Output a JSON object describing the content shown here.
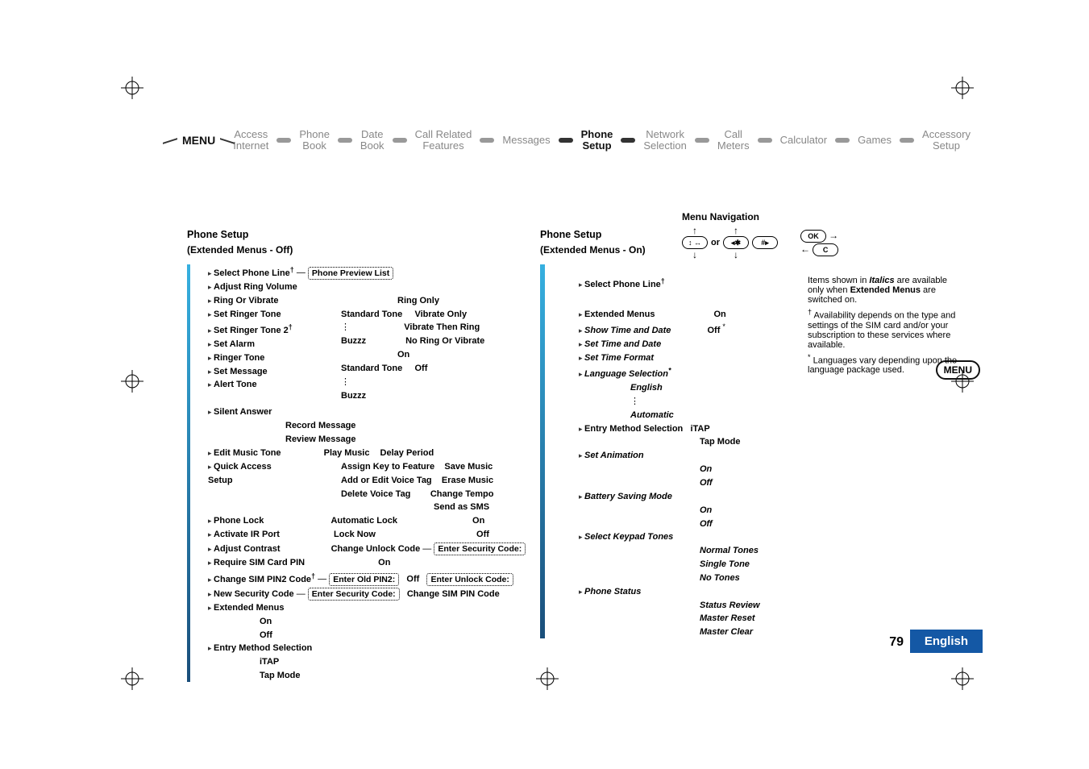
{
  "ribbon": {
    "label": "MENU",
    "items": [
      {
        "line1": "Access",
        "line2": "Internet"
      },
      {
        "line1": "Phone",
        "line2": "Book"
      },
      {
        "line1": "Date",
        "line2": "Book"
      },
      {
        "line1": "Call Related",
        "line2": "Features"
      },
      {
        "line1": "Messages",
        "line2": ""
      },
      {
        "line1": "Phone",
        "line2": "Setup",
        "active": true
      },
      {
        "line1": "Network",
        "line2": "Selection"
      },
      {
        "line1": "Call",
        "line2": "Meters"
      },
      {
        "line1": "Calculator",
        "line2": ""
      },
      {
        "line1": "Games",
        "line2": ""
      },
      {
        "line1": "Accessory",
        "line2": "Setup"
      }
    ]
  },
  "side_menu_badge": "MENU",
  "navkey": {
    "title": "Menu Navigation",
    "keys": {
      "nav": "↕ ↔",
      "star": "◂✱",
      "hash": "#▸",
      "ok": "OK",
      "c": "C"
    },
    "or": "or"
  },
  "notes": {
    "italics": "Items shown in ",
    "italics_word": "Italics",
    "italics_rest": " are available only when ",
    "extended_bold": "Extended Menus",
    "italics_end": " are switched on.",
    "dagger": "Availability depends on the type and settings of the SIM card and/or your subscription to these services where available.",
    "star": "Languages vary depending upon the language package used."
  },
  "left": {
    "title": "Phone Setup",
    "subtitle": "(Extended Menus - Off)",
    "phone_preview": "Phone Preview List",
    "items": {
      "select_line": "Select Phone Line",
      "adjust_ring_volume": "Adjust Ring Volume",
      "ring_or_vibrate": "Ring Or Vibrate",
      "ring_only": "Ring Only",
      "set_ringer_tone": "Set Ringer Tone",
      "set_ringer_tone2": "Set Ringer Tone 2",
      "standard_tone": "Standard Tone",
      "buzzz": "Buzzz",
      "vibrate_only": "Vibrate Only",
      "vibrate_then_ring": "Vibrate Then Ring",
      "no_ring_or_vibrate": "No Ring Or Vibrate",
      "set_alarm": "Set Alarm",
      "ringer_tone": "Ringer Tone",
      "on": "On",
      "off": "Off",
      "set_message": "Set Message",
      "alert_tone": "Alert Tone",
      "silent_answer": "Silent Answer",
      "record_message": "Record Message",
      "review_message": "Review Message",
      "delay_period": "Delay Period",
      "edit_music_tone": "Edit Music Tone",
      "play_music": "Play Music",
      "save_music": "Save Music",
      "quick_access": "Quick Access",
      "setup": "Setup",
      "assign_key": "Assign Key to Feature",
      "add_voice_tag": "Add or Edit Voice Tag",
      "delete_voice_tag": "Delete Voice Tag",
      "erase_music": "Erase Music",
      "change_tempo": "Change Tempo",
      "send_as_sms": "Send as SMS",
      "phone_lock": "Phone Lock",
      "automatic_lock": "Automatic Lock",
      "activate_ir": "Activate IR Port",
      "lock_now": "Lock Now",
      "adjust_contrast": "Adjust Contrast",
      "change_unlock_code": "Change Unlock Code",
      "enter_security_code": "Enter Security Code:",
      "require_sim_pin": "Require SIM Card PIN",
      "change_sim_pin2": "Change SIM PIN2 Code",
      "enter_old_pin2": "Enter Old PIN2:",
      "enter_unlock_code": "Enter Unlock Code:",
      "new_security_code": "New Security Code",
      "change_sim_pin": "Change SIM PIN Code",
      "extended_menus": "Extended Menus",
      "entry_method": "Entry Method Selection",
      "itap": "iTAP",
      "tap_mode": "Tap Mode"
    }
  },
  "right": {
    "title": "Phone Setup",
    "subtitle": "(Extended Menus - On)",
    "select_line": "Select Phone Line",
    "extended_menus": "Extended Menus",
    "on": "On",
    "off": "Off",
    "show_time_date": "Show Time and Date",
    "set_time_date": "Set Time and Date",
    "set_time_format": "Set Time Format",
    "language_selection": "Language Selection",
    "english": "English",
    "automatic": "Automatic",
    "entry_method": "Entry Method Selection",
    "itap": "iTAP",
    "tap_mode": "Tap Mode",
    "set_animation": "Set Animation",
    "battery_saving": "Battery Saving Mode",
    "select_keypad": "Select Keypad Tones",
    "normal_tones": "Normal Tones",
    "single_tone": "Single Tone",
    "no_tones": "No Tones",
    "phone_status": "Phone Status",
    "status_review": "Status Review",
    "master_reset": "Master Reset",
    "master_clear": "Master Clear"
  },
  "footer": {
    "page": "79",
    "lang": "English"
  }
}
